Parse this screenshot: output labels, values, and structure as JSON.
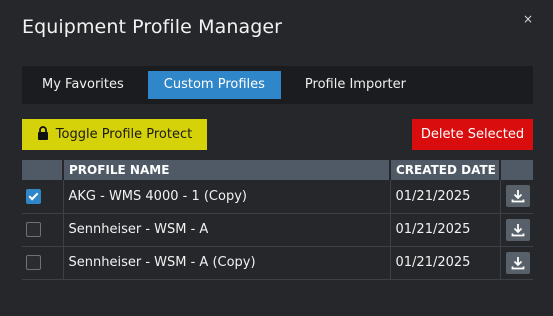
{
  "dialog": {
    "title": "Equipment Profile Manager",
    "close_label": "×"
  },
  "tabs": [
    {
      "label": "My Favorites",
      "active": false
    },
    {
      "label": "Custom Profiles",
      "active": true
    },
    {
      "label": "Profile Importer",
      "active": false
    }
  ],
  "toolbar": {
    "protect_label": "Toggle Profile Protect",
    "delete_label": "Delete Selected"
  },
  "table": {
    "headers": [
      "",
      "PROFILE NAME",
      "CREATED DATE",
      ""
    ],
    "rows": [
      {
        "checked": true,
        "name": "AKG - WMS 4000 - 1 (Copy)",
        "date": "01/21/2025"
      },
      {
        "checked": false,
        "name": "Sennheiser - WSM - A",
        "date": "01/21/2025"
      },
      {
        "checked": false,
        "name": "Sennheiser - WSM - A (Copy)",
        "date": "01/21/2025"
      }
    ]
  },
  "colors": {
    "background": "#25272b",
    "accent": "#2f86c8",
    "protect_button": "#d6d20a",
    "delete_button": "#d90d0d",
    "header": "#4f5a66"
  },
  "icons": {
    "close": "close-icon",
    "lock": "lock-icon",
    "download": "download-icon",
    "check": "checkmark-icon"
  }
}
